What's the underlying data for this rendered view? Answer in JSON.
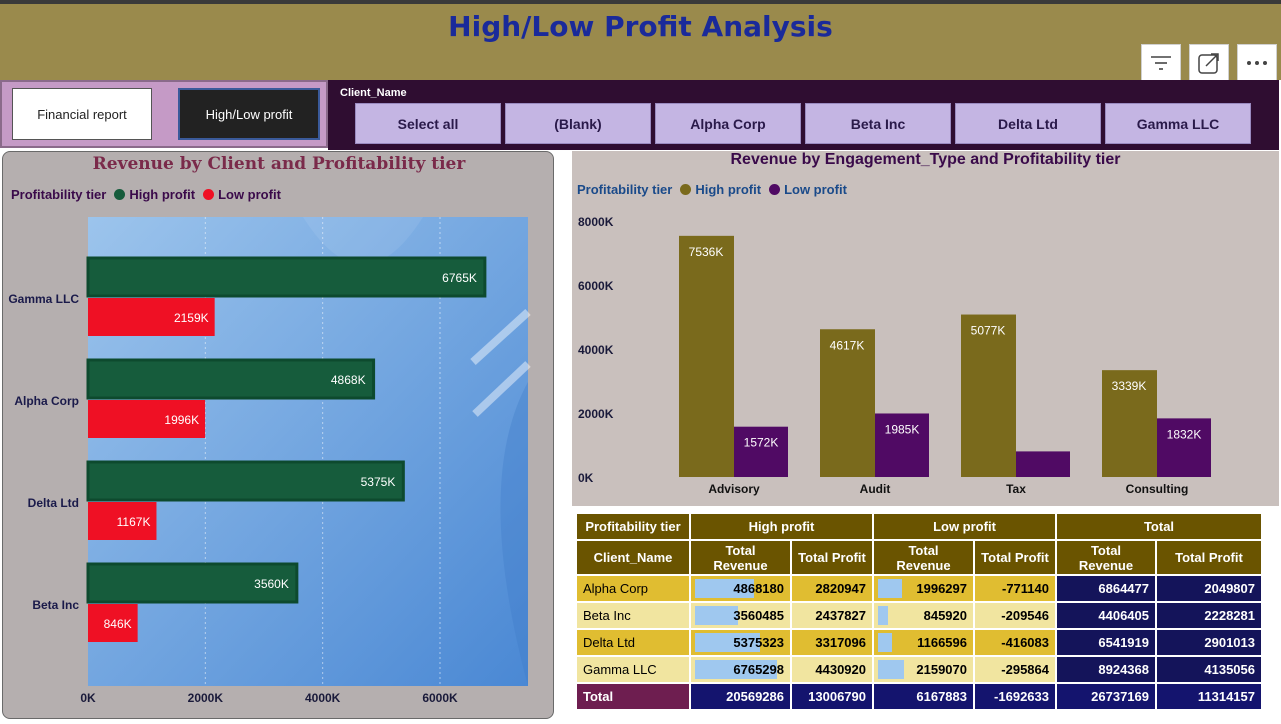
{
  "header": {
    "title": "High/Low Profit Analysis",
    "buttons": [
      {
        "icon": "filter-icon"
      },
      {
        "icon": "focus-mode-icon"
      },
      {
        "icon": "more-options-icon"
      }
    ]
  },
  "nav": {
    "financial_report": "Financial report",
    "high_low_profit": "High/Low profit"
  },
  "slicer": {
    "label": "Client_Name",
    "options": [
      "Select all",
      "(Blank)",
      "Alpha Corp",
      "Beta Inc",
      "Delta Ltd",
      "Gamma LLC"
    ]
  },
  "colors": {
    "high_profit_green": "#165c3c",
    "low_profit_red": "#ef1024",
    "high_profit_olive": "#7a6a1c",
    "low_profit_purple": "#500a64"
  },
  "chart_data": [
    {
      "type": "bar",
      "orientation": "horizontal",
      "title": "Revenue by Client and Profitability tier",
      "legend_title": "Profitability tier",
      "legend_position": "top-left",
      "categories": [
        "Gamma LLC",
        "Alpha Corp",
        "Delta Ltd",
        "Beta Inc"
      ],
      "series": [
        {
          "name": "High profit",
          "values": [
            6765,
            4868,
            5375,
            3560
          ],
          "labels": [
            "6765K",
            "4868K",
            "5375K",
            "3560K"
          ]
        },
        {
          "name": "Low profit",
          "values": [
            2159,
            1996,
            1167,
            846
          ],
          "labels": [
            "2159K",
            "1996K",
            "1167K",
            "846K"
          ]
        }
      ],
      "x_ticks": [
        "0K",
        "2000K",
        "4000K",
        "6000K"
      ],
      "xlim": [
        0,
        7500
      ],
      "grid": true
    },
    {
      "type": "bar",
      "title": "Revenue by Engagement_Type and Profitability tier",
      "legend_title": "Profitability tier",
      "legend_position": "top-left",
      "categories": [
        "Advisory",
        "Audit",
        "Tax",
        "Consulting"
      ],
      "series": [
        {
          "name": "High profit",
          "values": [
            7536,
            4617,
            5077,
            3339
          ],
          "labels": [
            "7536K",
            "4617K",
            "5077K",
            "3339K"
          ]
        },
        {
          "name": "Low profit",
          "values": [
            1572,
            1985,
            800,
            1832
          ],
          "labels": [
            "1572K",
            "1985K",
            "",
            "1832K"
          ]
        }
      ],
      "y_ticks": [
        "0K",
        "2000K",
        "4000K",
        "6000K",
        "8000K"
      ],
      "ylim": [
        0,
        8000
      ],
      "grid": false
    }
  ],
  "table": {
    "group_headers": [
      "Profitability tier",
      "High profit",
      "Low profit",
      "Total"
    ],
    "columns": [
      "Client_Name",
      "Total Revenue",
      "Total Profit",
      "Total Revenue",
      "Total Profit",
      "Total Revenue",
      "Total Profit"
    ],
    "rows": [
      {
        "client": "Alpha Corp",
        "hp_rev": "4868180",
        "hp_profit": "2820947",
        "lp_rev": "1996297",
        "lp_profit": "-771140",
        "t_rev": "6864477",
        "t_profit": "2049807"
      },
      {
        "client": "Beta Inc",
        "hp_rev": "3560485",
        "hp_profit": "2437827",
        "lp_rev": "845920",
        "lp_profit": "-209546",
        "t_rev": "4406405",
        "t_profit": "2228281"
      },
      {
        "client": "Delta Ltd",
        "hp_rev": "5375323",
        "hp_profit": "3317096",
        "lp_rev": "1166596",
        "lp_profit": "-416083",
        "t_rev": "6541919",
        "t_profit": "2901013"
      },
      {
        "client": "Gamma LLC",
        "hp_rev": "6765298",
        "hp_profit": "4430920",
        "lp_rev": "2159070",
        "lp_profit": "-295864",
        "t_rev": "8924368",
        "t_profit": "4135056"
      }
    ],
    "total": {
      "label": "Total",
      "hp_rev": "20569286",
      "hp_profit": "13006790",
      "lp_rev": "6167883",
      "lp_profit": "-1692633",
      "t_rev": "26737169",
      "t_profit": "11314157"
    }
  }
}
